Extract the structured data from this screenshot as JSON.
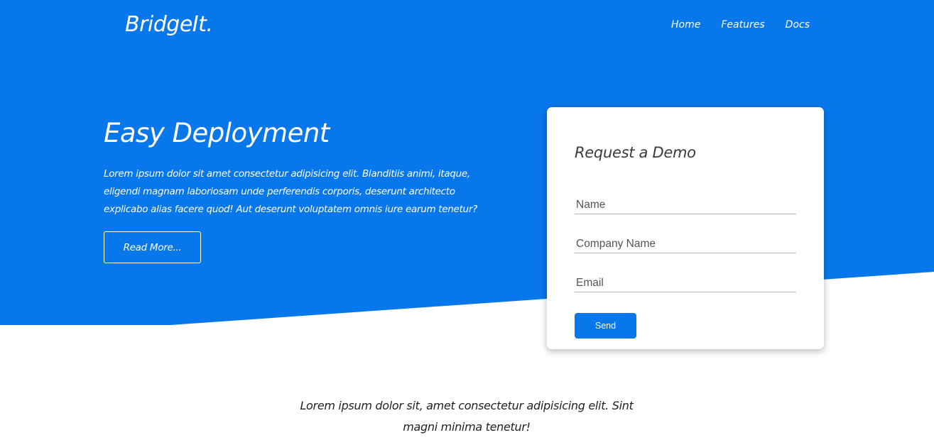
{
  "brand": {
    "logo": "BridgeIt.",
    "accent": "#0877eb"
  },
  "nav": {
    "items": [
      "Home",
      "Features",
      "Docs"
    ]
  },
  "hero": {
    "title": "Easy Deployment",
    "text": "Lorem ipsum dolor sit amet consectetur adipisicing elit. Blanditiis animi, itaque, eligendi magnam laboriosam unde perferendis corporis, deserunt architecto explicabo alias facere quod! Aut deserunt voluptatem omnis iure earum tenetur?",
    "button_label": "Read More..."
  },
  "form": {
    "title": "Request a Demo",
    "fields": [
      {
        "placeholder": "Name",
        "value": ""
      },
      {
        "placeholder": "Company Name",
        "value": ""
      },
      {
        "placeholder": "Email",
        "value": ""
      }
    ],
    "submit_label": "Send"
  },
  "tagline": "Lorem ipsum dolor sit, amet consectetur adipisicing elit. Sint magni minima tenetur!"
}
